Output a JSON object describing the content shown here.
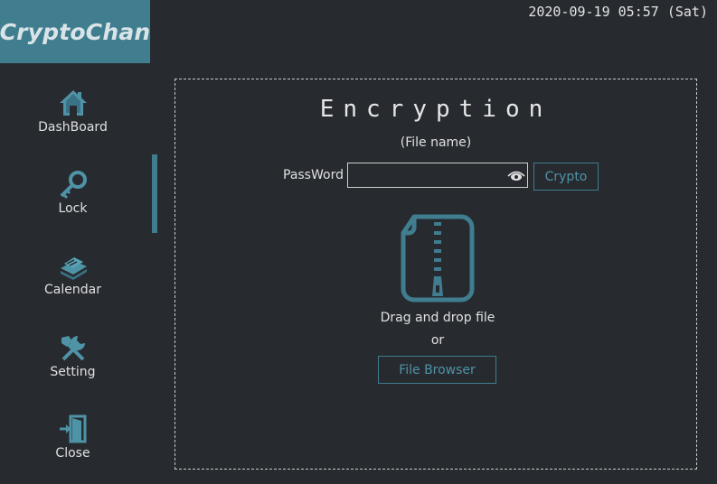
{
  "app": {
    "name": "CryptoChan",
    "datetime": "2020-09-19 05:57 (Sat)"
  },
  "sidebar": {
    "items": [
      {
        "label": "DashBoard",
        "icon": "house-icon",
        "active": false
      },
      {
        "label": "Lock",
        "icon": "key-icon",
        "active": true
      },
      {
        "label": "Calendar",
        "icon": "calendar-book-icon",
        "active": false
      },
      {
        "label": "Setting",
        "icon": "tools-icon",
        "active": false
      },
      {
        "label": "Close",
        "icon": "exit-door-icon",
        "active": false
      }
    ]
  },
  "encryption": {
    "title": "Encryption",
    "file_name": "(File name)",
    "password_label": "PassWord",
    "password_value": "",
    "crypto_button": "Crypto",
    "drop_text": "Drag and drop file",
    "or_text": "or",
    "file_browser_button": "File Browser"
  },
  "colors": {
    "accent": "#3f7d8f",
    "background": "#272b30",
    "text": "#e0e0e0"
  }
}
